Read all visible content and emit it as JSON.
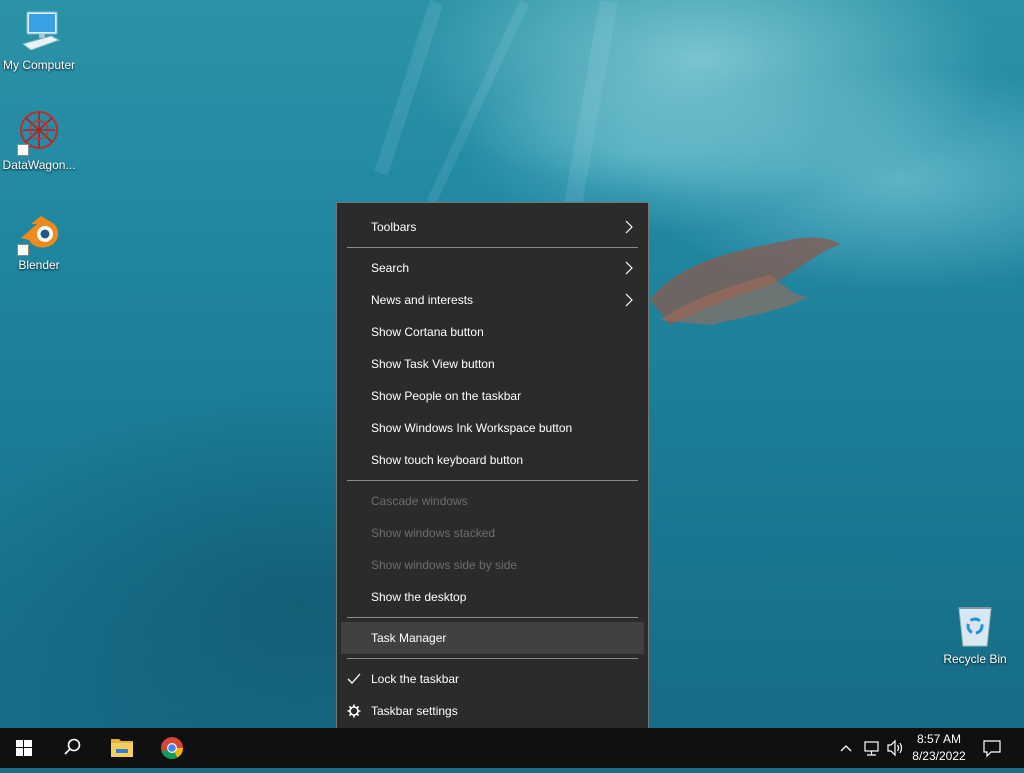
{
  "desktop": {
    "icons": [
      {
        "label": "My Computer",
        "icon": "computer-icon"
      },
      {
        "label": "DataWagon...",
        "icon": "datawagon-icon"
      },
      {
        "label": "Blender",
        "icon": "blender-icon"
      },
      {
        "label": "Recycle Bin",
        "icon": "recycle-bin-icon"
      }
    ]
  },
  "context_menu": {
    "items": [
      {
        "label": "Toolbars",
        "submenu": true
      },
      {
        "label": "Search",
        "submenu": true
      },
      {
        "label": "News and interests",
        "submenu": true
      },
      {
        "label": "Show Cortana button"
      },
      {
        "label": "Show Task View button"
      },
      {
        "label": "Show People on the taskbar"
      },
      {
        "label": "Show Windows Ink Workspace button"
      },
      {
        "label": "Show touch keyboard button"
      },
      {
        "label": "Cascade windows",
        "disabled": true
      },
      {
        "label": "Show windows stacked",
        "disabled": true
      },
      {
        "label": "Show windows side by side",
        "disabled": true
      },
      {
        "label": "Show the desktop"
      },
      {
        "label": "Task Manager",
        "highlighted": true
      },
      {
        "label": "Lock the taskbar",
        "checked": true
      },
      {
        "label": "Taskbar settings",
        "icon": "gear-icon"
      }
    ]
  },
  "taskbar": {
    "buttons": [
      "windows-start-icon",
      "search-icon",
      "file-explorer-icon",
      "chrome-icon"
    ],
    "tray": [
      "chevron-up-icon",
      "network-icon",
      "volume-icon",
      "notification-icon"
    ],
    "time": "8:57 AM",
    "date": "8/23/2022"
  },
  "colors": {
    "menu_bg": "#2b2b2b",
    "menu_hover": "#414141",
    "menu_disabled_text": "#6d6d6d",
    "taskbar_bg": "#101010"
  }
}
